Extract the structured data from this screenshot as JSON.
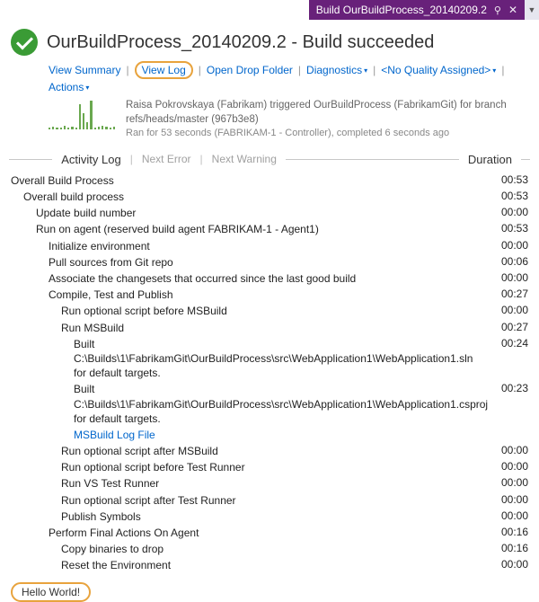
{
  "window": {
    "tab_title": "Build OurBuildProcess_20140209.2"
  },
  "header": {
    "title": "OurBuildProcess_20140209.2 - Build succeeded",
    "links": {
      "view_summary": "View Summary",
      "view_log": "View Log",
      "open_drop": "Open Drop Folder",
      "diagnostics": "Diagnostics",
      "quality": "<No Quality Assigned>",
      "actions": "Actions"
    },
    "meta": {
      "line1": "Raisa Pokrovskaya (Fabrikam) triggered OurBuildProcess (FabrikamGit) for branch refs/heads/master (967b3e8)",
      "line2": "Ran for 53 seconds (FABRIKAM-1 - Controller), completed 6 seconds ago"
    }
  },
  "section": {
    "activity_log": "Activity Log",
    "next_error": "Next Error",
    "next_warning": "Next Warning",
    "duration": "Duration"
  },
  "log": [
    {
      "indent": 0,
      "text": "Overall Build Process",
      "dur": "00:53"
    },
    {
      "indent": 1,
      "text": "Overall build process",
      "dur": "00:53"
    },
    {
      "indent": 2,
      "text": "Update build number",
      "dur": "00:00"
    },
    {
      "indent": 2,
      "text": "Run on agent (reserved build agent FABRIKAM-1 - Agent1)",
      "dur": "00:53"
    },
    {
      "indent": 3,
      "text": "Initialize environment",
      "dur": "00:00"
    },
    {
      "indent": 3,
      "text": "Pull sources from Git repo",
      "dur": "00:06"
    },
    {
      "indent": 3,
      "text": "Associate the changesets that occurred since the last good build",
      "dur": "00:00"
    },
    {
      "indent": 3,
      "text": "Compile, Test and Publish",
      "dur": "00:27"
    },
    {
      "indent": 4,
      "text": "Run optional script before MSBuild",
      "dur": "00:00"
    },
    {
      "indent": 4,
      "text": "Run MSBuild",
      "dur": "00:27"
    },
    {
      "indent": 5,
      "text": "Built C:\\Builds\\1\\FabrikamGit\\OurBuildProcess\\src\\WebApplication1\\WebApplication1.sln for default targets.",
      "dur": "00:24"
    },
    {
      "indent": 5,
      "text": "Built C:\\Builds\\1\\FabrikamGit\\OurBuildProcess\\src\\WebApplication1\\WebApplication1.csproj for default targets.",
      "dur": "00:23"
    },
    {
      "indent": 5,
      "text": "MSBuild Log File",
      "dur": "",
      "link": true
    },
    {
      "indent": 4,
      "text": "Run optional script after MSBuild",
      "dur": "00:00"
    },
    {
      "indent": 4,
      "text": "Run optional script before Test Runner",
      "dur": "00:00"
    },
    {
      "indent": 4,
      "text": "Run VS Test Runner",
      "dur": "00:00"
    },
    {
      "indent": 4,
      "text": "Run optional script after Test Runner",
      "dur": "00:00"
    },
    {
      "indent": 4,
      "text": "Publish Symbols",
      "dur": "00:00"
    },
    {
      "indent": 3,
      "text": "Perform Final Actions On Agent",
      "dur": "00:16"
    },
    {
      "indent": 4,
      "text": "Copy binaries to drop",
      "dur": "00:16"
    },
    {
      "indent": 4,
      "text": "Reset the Environment",
      "dur": "00:00"
    }
  ],
  "footer": {
    "hello": "Hello World!"
  },
  "spark_heights": [
    2,
    3,
    2,
    2,
    4,
    2,
    3,
    2,
    28,
    18,
    8,
    32,
    2,
    3,
    4,
    3,
    2,
    3
  ]
}
